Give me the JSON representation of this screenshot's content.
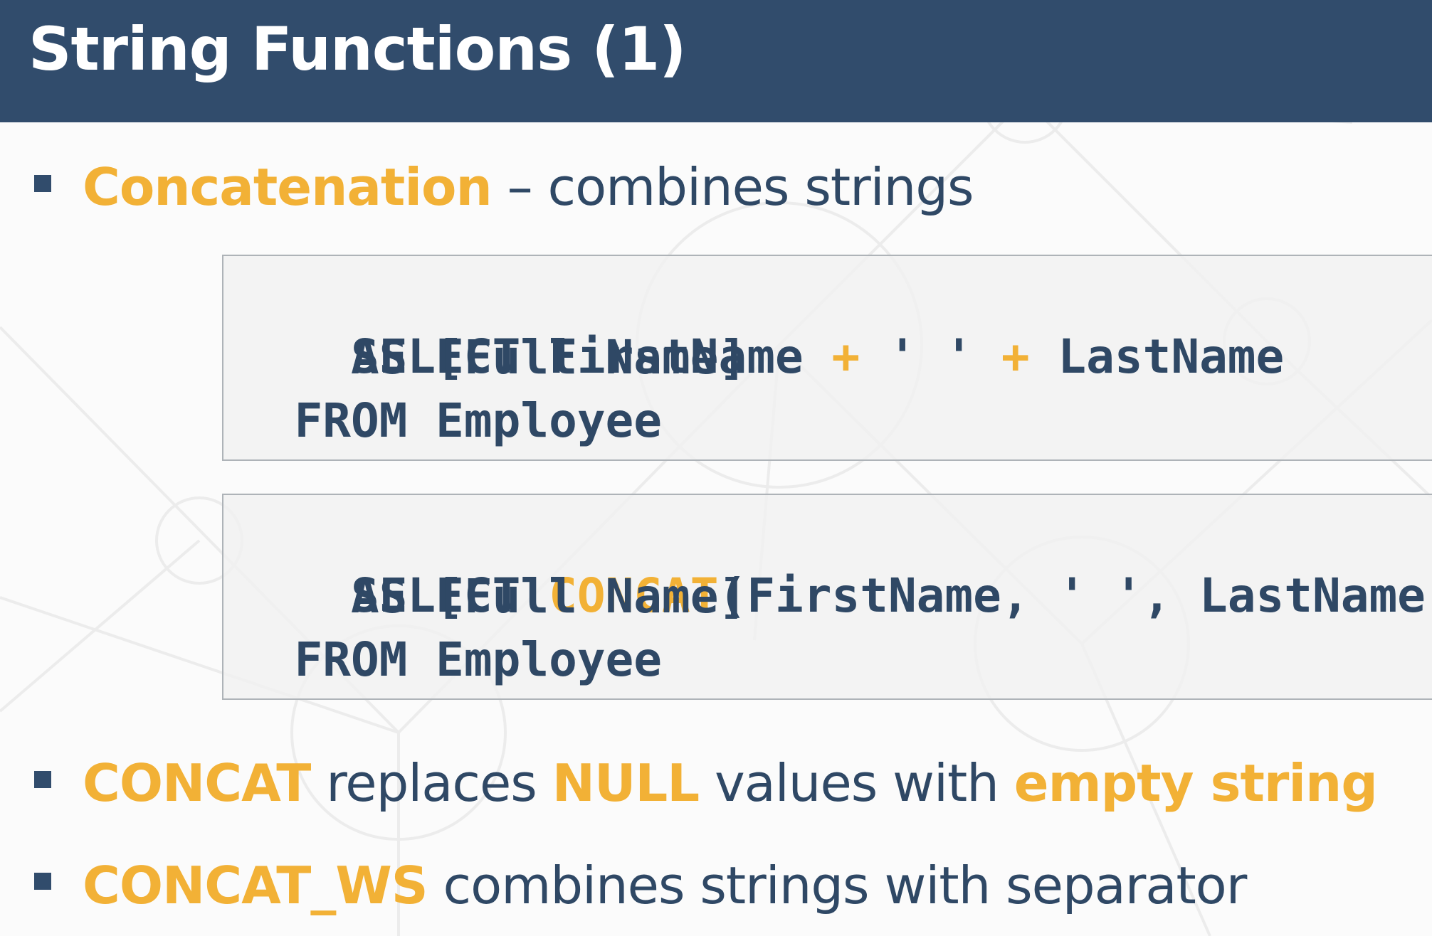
{
  "slide": {
    "title": "String Functions (1)"
  },
  "bullets": [
    {
      "highlight": "Concatenation",
      "text": " – combines strings"
    },
    {
      "part1": "CONCAT",
      "part2": " replaces ",
      "part3": "NULL",
      "part4": " values with ",
      "part5": "empty string"
    },
    {
      "highlight": "CONCAT_WS",
      "text": "  combines strings with separator"
    }
  ],
  "code_blocks": [
    {
      "lines": [
        {
          "kw": "SELECT ",
          "a": "FirstName ",
          "op1": "+",
          "b": " ' ' ",
          "op2": "+",
          "c": " LastName"
        },
        {
          "text": "    AS [Full Name]"
        },
        {
          "text": "  FROM Employee"
        }
      ]
    },
    {
      "lines": [
        {
          "kw": "SELECT ",
          "fn": "CONCAT",
          "rest": "(FirstName, ' ', LastName)"
        },
        {
          "text": "    AS [Full Name]"
        },
        {
          "text": "  FROM Employee"
        }
      ]
    }
  ],
  "colors": {
    "title_bar": "#314c6c",
    "text": "#2f4865",
    "accent": "#f2b136",
    "code_background": "#f0f0f0",
    "code_border": "#aeb3b8"
  }
}
